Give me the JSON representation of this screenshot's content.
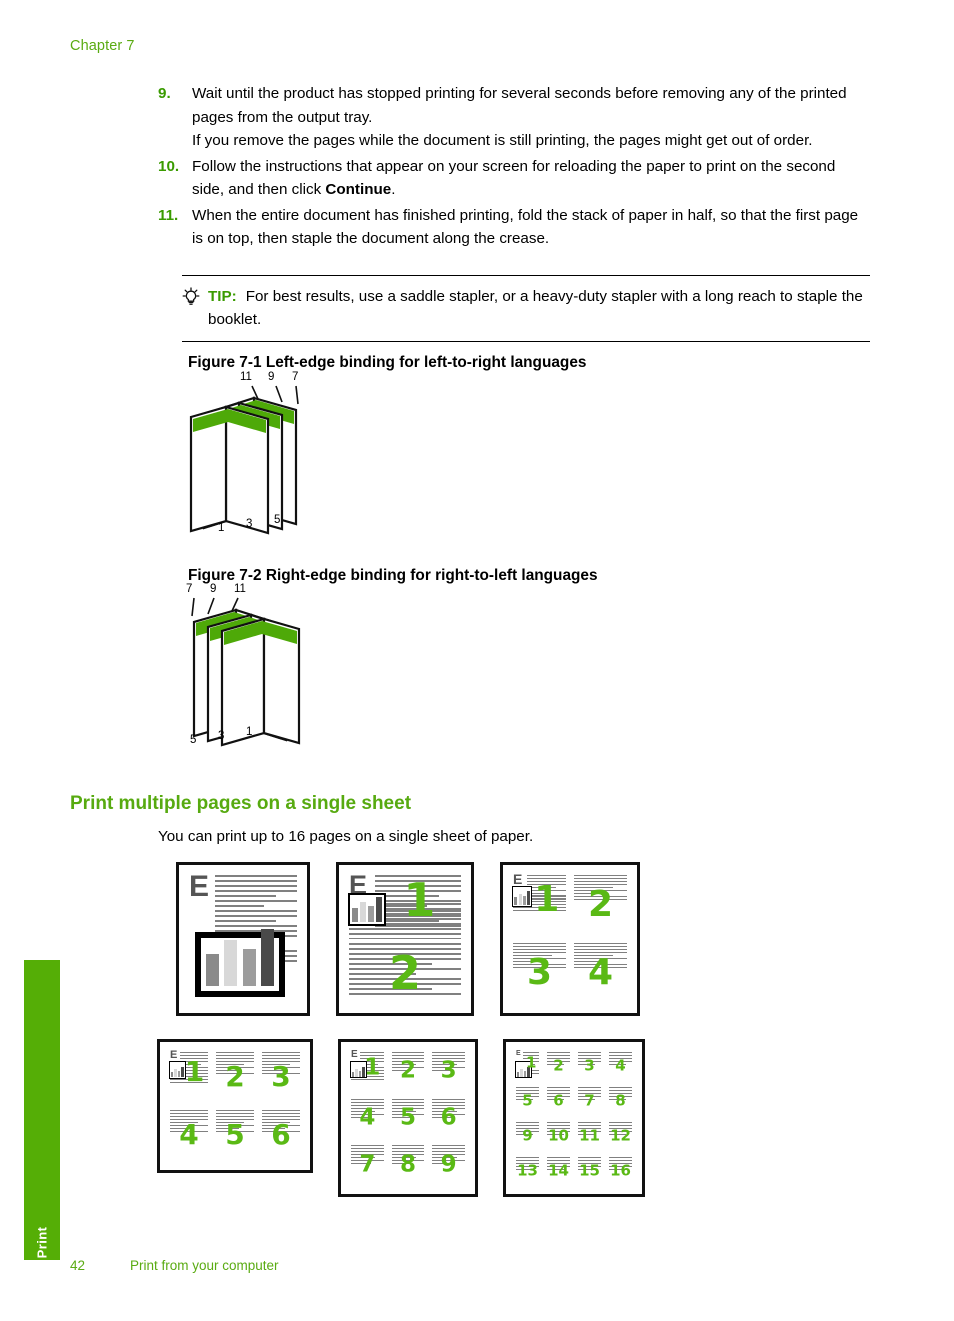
{
  "header": {
    "chapter": "Chapter 7"
  },
  "side_tab": {
    "label": "Print",
    "color": "#55ae06"
  },
  "footer": {
    "page_number": "42",
    "section": "Print from your computer"
  },
  "steps": [
    {
      "number": "9.",
      "paragraphs": [
        "Wait until the product has stopped printing for several seconds before removing any of the printed pages from the output tray.",
        "If you remove the pages while the document is still printing, the pages might get out of order."
      ]
    },
    {
      "number": "10.",
      "paragraphs": [
        "Follow the instructions that appear on your screen for reloading the paper to print on the second side, and then click "
      ],
      "bold_tail": "Continue",
      "tail": "."
    },
    {
      "number": "11.",
      "paragraphs": [
        "When the entire document has finished printing, fold the stack of paper in half, so that the first page is on top, then staple the document along the crease."
      ]
    }
  ],
  "tip": {
    "icon": "lightbulb-icon",
    "label": "TIP:",
    "text": "For best results, use a saddle stapler, or a heavy-duty stapler with a long reach to staple the booklet."
  },
  "figures": [
    {
      "id": "figure-7-1",
      "caption": "Figure 7-1 Left-edge binding for left-to-right languages",
      "top_labels": [
        "11",
        "9",
        "7"
      ],
      "bottom_labels": [
        "1",
        "3",
        "5"
      ]
    },
    {
      "id": "figure-7-2",
      "caption": "Figure 7-2 Right-edge binding for right-to-left languages",
      "top_labels": [
        "7",
        "9",
        "11"
      ],
      "bottom_labels": [
        "5",
        "3",
        "1"
      ]
    }
  ],
  "section": {
    "heading": "Print multiple pages on a single sheet",
    "intro": "You can print up to 16 pages on a single sheet of paper."
  },
  "nup_layouts": [
    {
      "name": "1-up",
      "cols": 1,
      "rows": 1,
      "numbers": []
    },
    {
      "name": "2-up",
      "cols": 1,
      "rows": 2,
      "numbers": [
        "1",
        "2"
      ]
    },
    {
      "name": "4-up",
      "cols": 2,
      "rows": 2,
      "numbers": [
        "1",
        "2",
        "3",
        "4"
      ]
    },
    {
      "name": "6-up",
      "cols": 3,
      "rows": 2,
      "numbers": [
        "1",
        "2",
        "3",
        "4",
        "5",
        "6"
      ]
    },
    {
      "name": "9-up",
      "cols": 3,
      "rows": 3,
      "numbers": [
        "1",
        "2",
        "3",
        "4",
        "5",
        "6",
        "7",
        "8",
        "9"
      ]
    },
    {
      "name": "16-up",
      "cols": 4,
      "rows": 4,
      "numbers": [
        "1",
        "2",
        "3",
        "4",
        "5",
        "6",
        "7",
        "8",
        "9",
        "10",
        "11",
        "12",
        "13",
        "14",
        "15",
        "16"
      ]
    }
  ],
  "colors": {
    "brand_green": "#55ae06",
    "heading_green": "#57aa10",
    "number_green": "#3a9b00",
    "page_number_green": "#5ab915",
    "text_black": "#000000"
  },
  "dropcap_letter": "E"
}
